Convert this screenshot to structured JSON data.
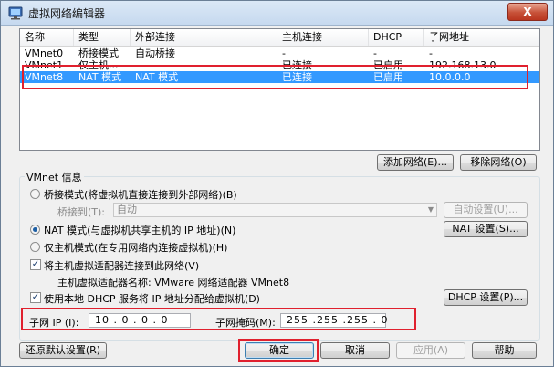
{
  "window": {
    "title": "虚拟网络编辑器",
    "close_label": "X"
  },
  "network_table": {
    "columns": [
      "名称",
      "类型",
      "外部连接",
      "主机连接",
      "DHCP",
      "子网地址"
    ],
    "rows": [
      {
        "name": "VMnet0",
        "type": "桥接模式",
        "external": "自动桥接",
        "host": "-",
        "dhcp": "-",
        "subnet": "-"
      },
      {
        "name": "VMnet1",
        "type": "仅主机...",
        "external": "-",
        "host": "已连接",
        "dhcp": "已启用",
        "subnet": "192.168.13.0"
      },
      {
        "name": "VMnet8",
        "type": "NAT 模式",
        "external": "NAT 模式",
        "host": "已连接",
        "dhcp": "已启用",
        "subnet": "10.0.0.0"
      }
    ],
    "selected_row": 2
  },
  "table_buttons": {
    "add": "添加网络(E)...",
    "remove": "移除网络(O)"
  },
  "vmnet_info": {
    "group_title": "VMnet 信息",
    "bridge_mode_label": "桥接模式(将虚拟机直接连接到外部网络)(B)",
    "bridge_to_label": "桥接到(T):",
    "bridge_to_value": "自动",
    "auto_settings": "自动设置(U)...",
    "nat_mode_label": "NAT 模式(与虚拟机共享主机的 IP 地址)(N)",
    "nat_settings": "NAT 设置(S)...",
    "host_only_label": "仅主机模式(在专用网络内连接虚拟机)(H)",
    "selected_mode": "nat",
    "connect_adapter_label": "将主机虚拟适配器连接到此网络(V)",
    "connect_adapter_checked": true,
    "adapter_name_label": "主机虚拟适配器名称: VMware 网络适配器 VMnet8",
    "use_dhcp_label": "使用本地 DHCP 服务将 IP 地址分配给虚拟机(D)",
    "use_dhcp_checked": true,
    "dhcp_settings": "DHCP 设置(P)...",
    "subnet_ip_label": "子网 IP (I):",
    "subnet_ip_value": "10 . 0 . 0 . 0",
    "subnet_mask_label": "子网掩码(M):",
    "subnet_mask_value": "255 .255 .255 . 0"
  },
  "footer_buttons": {
    "restore": "还原默认设置(R)",
    "ok": "确定",
    "cancel": "取消",
    "apply": "应用(A)",
    "help": "帮助"
  },
  "colors": {
    "selection": "#3399ff",
    "highlight_box": "#e0202e"
  },
  "icons": {
    "app": "network-editor-icon",
    "checkmark": "✓"
  }
}
